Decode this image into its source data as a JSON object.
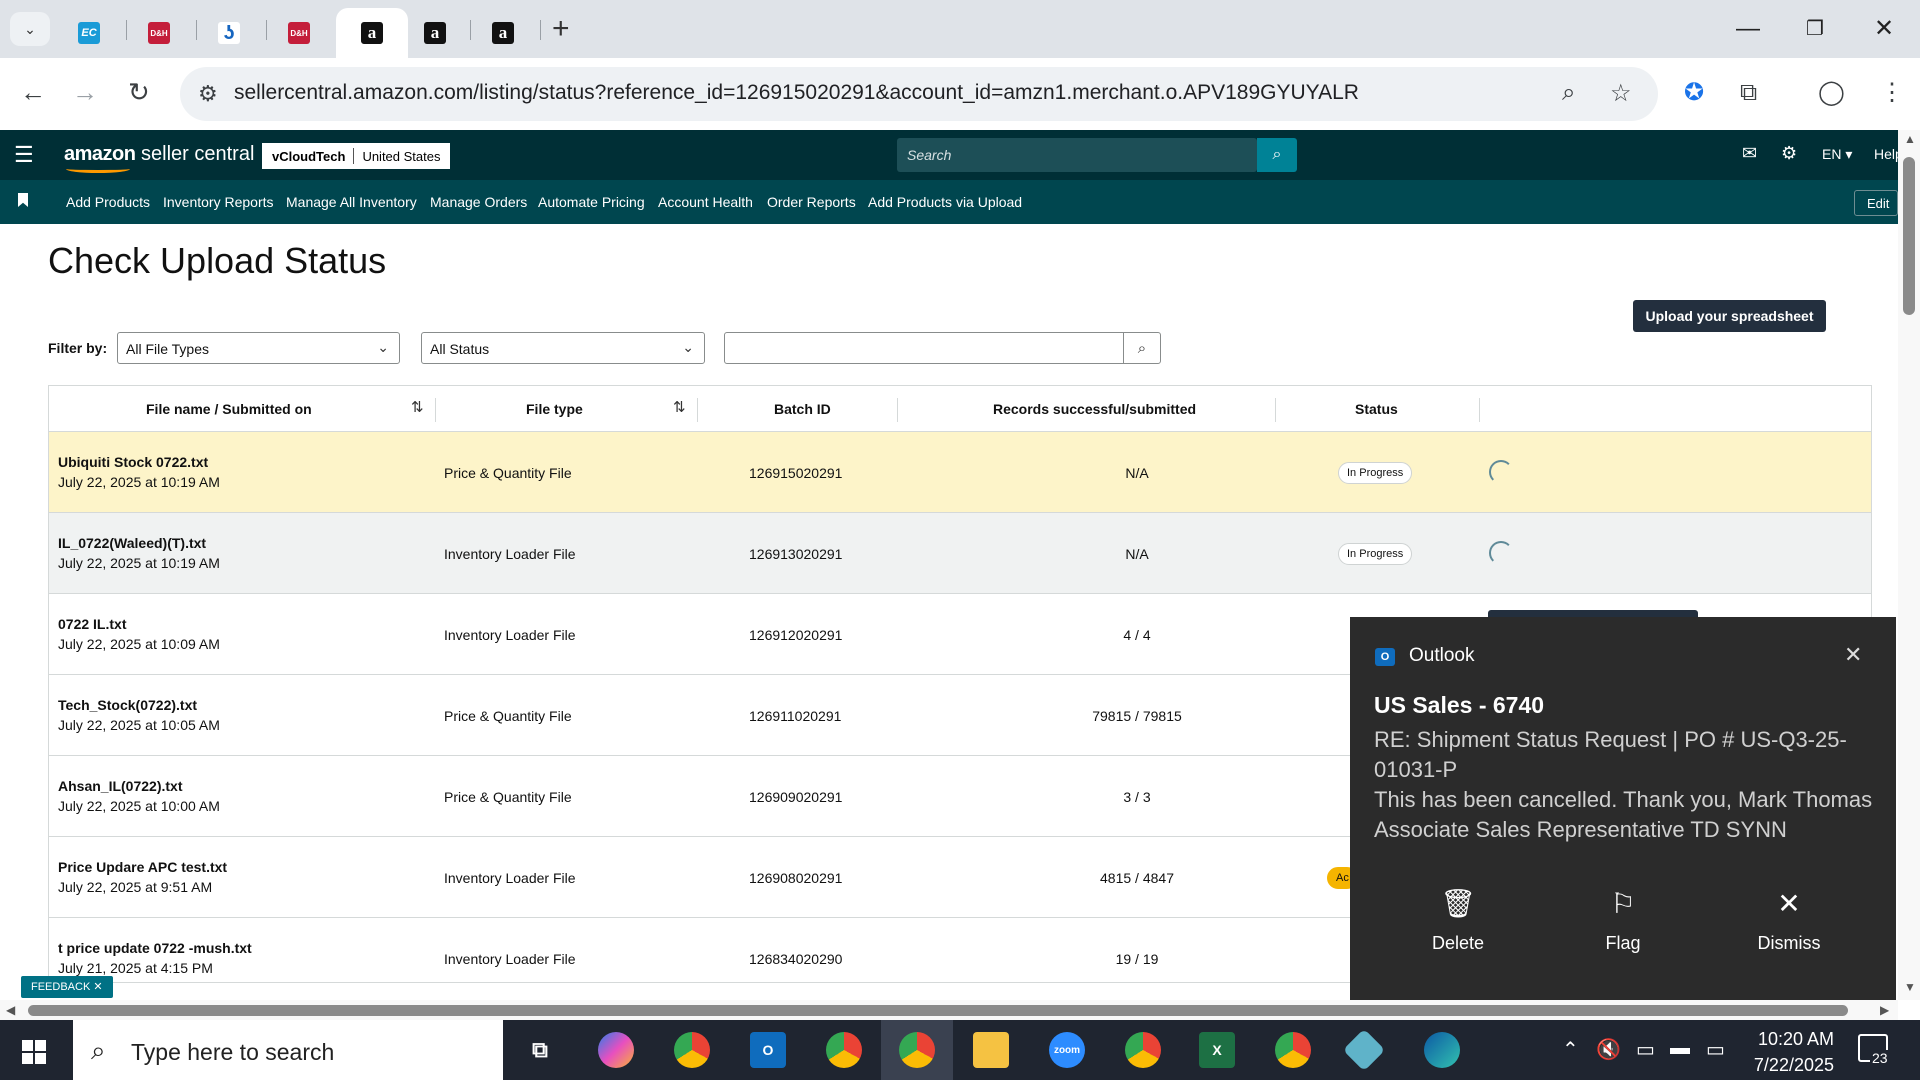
{
  "browser": {
    "url": "sellercentral.amazon.com/listing/status?reference_id=126915020291&account_id=amzn1.merchant.o.APV189GYUYALR",
    "tabs": [
      {
        "icon": "ec-favicon",
        "text": "EC"
      },
      {
        "icon": "dh-favicon",
        "text": "D&H"
      },
      {
        "icon": "blue-favicon",
        "text": "ʖ"
      },
      {
        "icon": "dh-favicon",
        "text": "D&H"
      },
      {
        "icon": "amazon-favicon",
        "text": "a"
      },
      {
        "icon": "amazon-favicon",
        "text": "a"
      },
      {
        "icon": "amazon-favicon",
        "text": "a"
      }
    ]
  },
  "header": {
    "logo_brand": "amazon",
    "logo_product": "seller central",
    "store_name": "vCloudTech",
    "marketplace": "United States",
    "search_placeholder": "Search",
    "language": "EN ▾",
    "help": "Help"
  },
  "subnav": {
    "items": [
      "Add Products",
      "Inventory Reports",
      "Manage All Inventory",
      "Manage Orders",
      "Automate Pricing",
      "Account Health",
      "Order Reports",
      "Add Products via Upload"
    ],
    "edit": "Edit"
  },
  "page": {
    "title": "Check Upload Status",
    "upload_button": "Upload your spreadsheet",
    "filter_label": "Filter by:",
    "file_type_select": "All File Types",
    "status_select": "All Status",
    "feedback": "FEEDBACK"
  },
  "table": {
    "headers": [
      "File name / Submitted on",
      "File type",
      "Batch ID",
      "Records successful/submitted",
      "Status"
    ],
    "rows": [
      {
        "name": "Ubiquiti Stock 0722.txt",
        "date": "July 22, 2025 at 10:19 AM",
        "type": "Price & Quantity File",
        "batch": "126915020291",
        "records": "N/A",
        "status": "In Progress"
      },
      {
        "name": "IL_0722(Waleed)(T).txt",
        "date": "July 22, 2025 at 10:19 AM",
        "type": "Inventory Loader File",
        "batch": "126913020291",
        "records": "N/A",
        "status": "In Progress"
      },
      {
        "name": "0722 IL.txt",
        "date": "July 22, 2025 at 10:09 AM",
        "type": "Inventory Loader File",
        "batch": "126912020291",
        "records": "4 / 4",
        "status": ""
      },
      {
        "name": "Tech_Stock(0722).txt",
        "date": "July 22, 2025 at 10:05 AM",
        "type": "Price & Quantity File",
        "batch": "126911020291",
        "records": "79815 / 79815",
        "status": ""
      },
      {
        "name": "Ahsan_IL(0722).txt",
        "date": "July 22, 2025 at 10:00 AM",
        "type": "Price & Quantity File",
        "batch": "126909020291",
        "records": "3 / 3",
        "status": ""
      },
      {
        "name": "Price Updare APC test.txt",
        "date": "July 22, 2025 at 9:51 AM",
        "type": "Inventory Loader File",
        "batch": "126908020291",
        "records": "4815 / 4847",
        "status": "Ac"
      },
      {
        "name": "t price update 0722 -mush.txt",
        "date": "July 21, 2025 at 4:15 PM",
        "type": "Inventory Loader File",
        "batch": "126834020290",
        "records": "19 / 19",
        "status": ""
      }
    ]
  },
  "toast": {
    "app": "Outlook",
    "title": "US Sales - 6740",
    "body_line1": "RE: Shipment Status Request | PO # US-Q3-25-01031-P",
    "body_line2": "This has been cancelled.  Thank you,    Mark Thomas  Associate Sales Representative  TD SYNN",
    "actions": [
      "Delete",
      "Flag",
      "Dismiss"
    ]
  },
  "taskbar": {
    "search_placeholder": "Type here to search",
    "time": "10:20 AM",
    "date": "7/22/2025",
    "notification_count": "23"
  },
  "colors": {
    "header_bg": "#002f36",
    "subnav_bg": "#00464f",
    "highlight_row": "#fdf4c9",
    "toast_bg": "#2b2b2b",
    "accent": "#ff9900"
  }
}
